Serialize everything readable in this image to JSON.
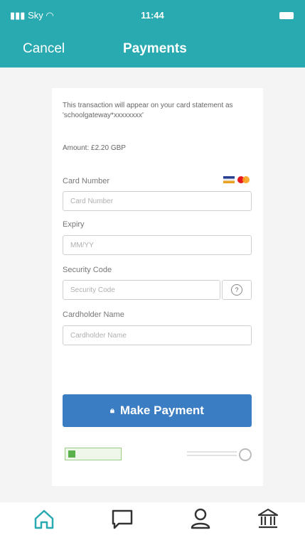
{
  "status_bar": {
    "carrier": "Sky",
    "time": "11:44"
  },
  "header": {
    "cancel_label": "Cancel",
    "title": "Payments"
  },
  "form": {
    "disclaimer": "This transaction will appear on your card statement as 'schoolgateway*xxxxxxxx'",
    "amount": "Amount: £2.20 GBP",
    "card_number_label": "Card Number",
    "card_number_placeholder": "Card Number",
    "expiry_label": "Expiry",
    "expiry_placeholder": "MM/YY",
    "security_code_label": "Security Code",
    "security_code_placeholder": "Security Code",
    "help_icon": "?",
    "cardholder_label": "Cardholder Name",
    "cardholder_placeholder": "Cardholder Name",
    "pay_button": "Make Payment"
  },
  "tabbar": {
    "icons": [
      "home-icon",
      "chat-icon",
      "user-icon",
      "bank-icon"
    ]
  },
  "colors": {
    "header_bg": "#29aab1",
    "button_bg": "#3b7dc2"
  }
}
